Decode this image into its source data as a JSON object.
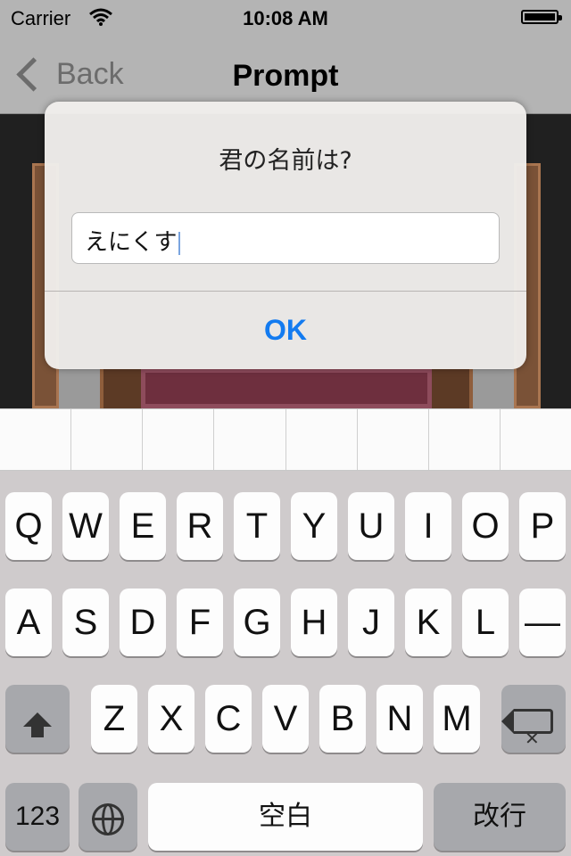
{
  "status_bar": {
    "carrier": "Carrier",
    "time": "10:08 AM"
  },
  "nav": {
    "back_label": "Back",
    "title": "Prompt"
  },
  "alert": {
    "message": "君の名前は?",
    "input_value": "えにくす",
    "ok_label": "OK"
  },
  "keyboard": {
    "row1": [
      "Q",
      "W",
      "E",
      "R",
      "T",
      "Y",
      "U",
      "I",
      "O",
      "P"
    ],
    "row2": [
      "A",
      "S",
      "D",
      "F",
      "G",
      "H",
      "J",
      "K",
      "L",
      "—"
    ],
    "row3": [
      "Z",
      "X",
      "C",
      "V",
      "B",
      "N",
      "M"
    ],
    "numbers_label": "123",
    "space_label": "空白",
    "return_label": "改行"
  },
  "icons": {
    "wifi": "wifi-icon",
    "battery": "battery-icon",
    "shift": "shift-icon",
    "delete": "delete-icon",
    "globe": "globe-icon"
  }
}
